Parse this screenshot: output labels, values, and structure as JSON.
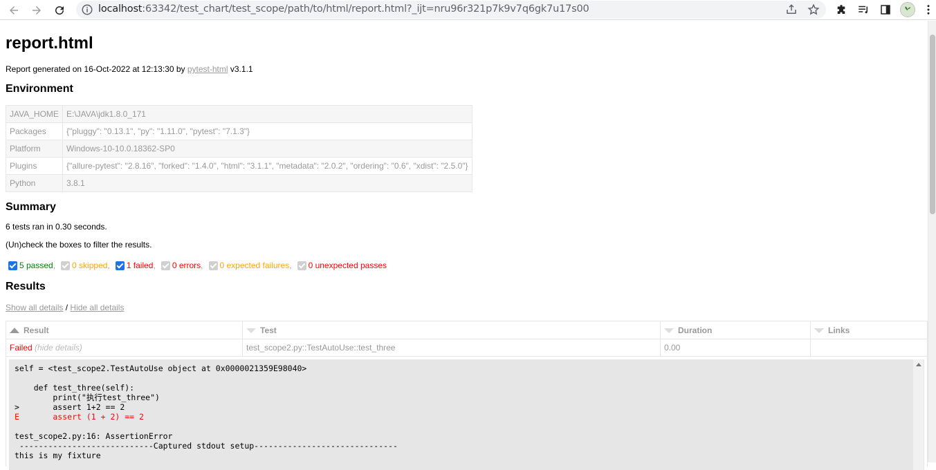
{
  "browser": {
    "url_host": "localhost",
    "url_rest": ":63342/test_chart/test_scope/path/to/html/report.html?_ijt=nru96r321p7k9v7q6gk7u17s00"
  },
  "report": {
    "title": "report.html",
    "generated_prefix": "Report generated on 16-Oct-2022 at 12:13:30 by ",
    "generated_link": "pytest-html",
    "generated_suffix": " v3.1.1"
  },
  "environment": {
    "heading": "Environment",
    "rows": [
      {
        "key": "JAVA_HOME",
        "value": "E:\\JAVA\\jdk1.8.0_171"
      },
      {
        "key": "Packages",
        "value": "{\"pluggy\": \"0.13.1\", \"py\": \"1.11.0\", \"pytest\": \"7.1.3\"}"
      },
      {
        "key": "Platform",
        "value": "Windows-10-10.0.18362-SP0"
      },
      {
        "key": "Plugins",
        "value": "{\"allure-pytest\": \"2.8.16\", \"forked\": \"1.4.0\", \"html\": \"3.1.1\", \"metadata\": \"2.0.2\", \"ordering\": \"0.6\", \"xdist\": \"2.5.0\"}"
      },
      {
        "key": "Python",
        "value": "3.8.1"
      }
    ]
  },
  "summary": {
    "heading": "Summary",
    "ran": "6 tests ran in 0.30 seconds.",
    "hint": "(Un)check the boxes to filter the results.",
    "filters": [
      {
        "label": "5 passed",
        "checked": true
      },
      {
        "label": "0 skipped",
        "checked": false
      },
      {
        "label": "1 failed",
        "checked": true
      },
      {
        "label": "0 errors",
        "checked": false
      },
      {
        "label": "0 expected failures",
        "checked": false
      },
      {
        "label": "0 unexpected passes",
        "checked": false
      }
    ]
  },
  "results": {
    "heading": "Results",
    "show_all": "Show all details",
    "divider": " / ",
    "hide_all": "Hide all details",
    "columns": [
      "Result",
      "Test",
      "Duration",
      "Links"
    ],
    "row": {
      "result": "Failed",
      "hide_details": "(hide details)",
      "test": "test_scope2.py::TestAutoUse::test_three",
      "duration": "0.00",
      "links": ""
    },
    "log_lines": [
      "self = <test_scope2.TestAutoUse object at 0x0000021359E98040>",
      "",
      "    def test_three(self):",
      "        print(\"执行test_three\")",
      ">       assert 1+2 == 2",
      "E       assert (1 + 2) == 2",
      "",
      "test_scope2.py:16: AssertionError",
      " ----------------------------Captured stdout setup------------------------------",
      "this is my fixture"
    ]
  },
  "colors": {
    "passed": "#008000",
    "skipped": "#ffa500",
    "failed": "#ff0000"
  }
}
